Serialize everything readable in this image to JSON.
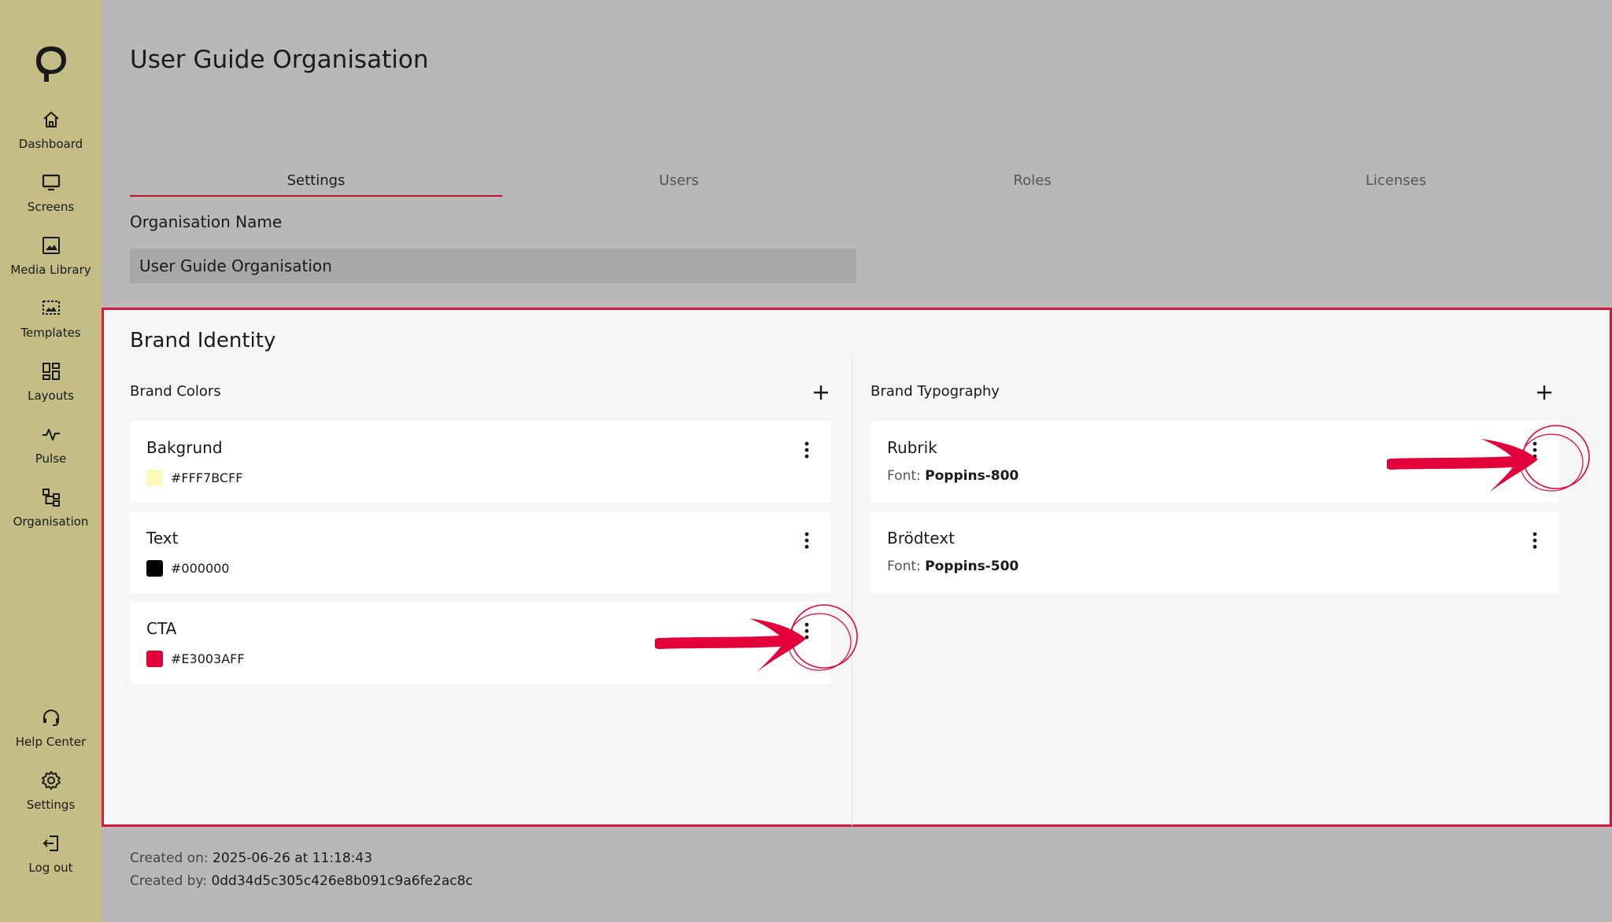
{
  "sidebar": {
    "items": [
      {
        "label": "Dashboard",
        "icon": "home-icon"
      },
      {
        "label": "Screens",
        "icon": "monitor-icon"
      },
      {
        "label": "Media Library",
        "icon": "image-icon"
      },
      {
        "label": "Templates",
        "icon": "template-icon"
      },
      {
        "label": "Layouts",
        "icon": "grid-icon"
      },
      {
        "label": "Pulse",
        "icon": "pulse-icon"
      },
      {
        "label": "Organisation",
        "icon": "org-icon"
      }
    ],
    "bottom_items": [
      {
        "label": "Help Center",
        "icon": "headset-icon"
      },
      {
        "label": "Settings",
        "icon": "gear-icon"
      },
      {
        "label": "Log out",
        "icon": "logout-icon"
      }
    ]
  },
  "header": {
    "title": "User Guide Organisation"
  },
  "tabs": [
    {
      "label": "Settings",
      "active": true
    },
    {
      "label": "Users",
      "active": false
    },
    {
      "label": "Roles",
      "active": false
    },
    {
      "label": "Licenses",
      "active": false
    }
  ],
  "org_name": {
    "label": "Organisation Name",
    "value": "User Guide Organisation"
  },
  "brand": {
    "title": "Brand Identity",
    "colors_label": "Brand Colors",
    "typography_label": "Brand Typography",
    "colors": [
      {
        "name": "Bakgrund",
        "hex": "#FFF7BCFF",
        "swatch": "#fff7bc"
      },
      {
        "name": "Text",
        "hex": "#000000",
        "swatch": "#000000"
      },
      {
        "name": "CTA",
        "hex": "#E3003AFF",
        "swatch": "#e3003a"
      }
    ],
    "typography": [
      {
        "name": "Rubrik",
        "font_prefix": "Font:",
        "font": "Poppins-800"
      },
      {
        "name": "Brödtext",
        "font_prefix": "Font:",
        "font": "Poppins-500"
      }
    ]
  },
  "footer": {
    "created_on_label": "Created on:",
    "created_on": "2025-06-26 at 11:18:43",
    "created_by_label": "Created by:",
    "created_by": "0dd34d5c305c426e8b091c9a6fe2ac8c"
  },
  "colors": {
    "accent": "#d7163d",
    "sidebar": "#c4bd86",
    "overlay": "#b8b8b8"
  }
}
